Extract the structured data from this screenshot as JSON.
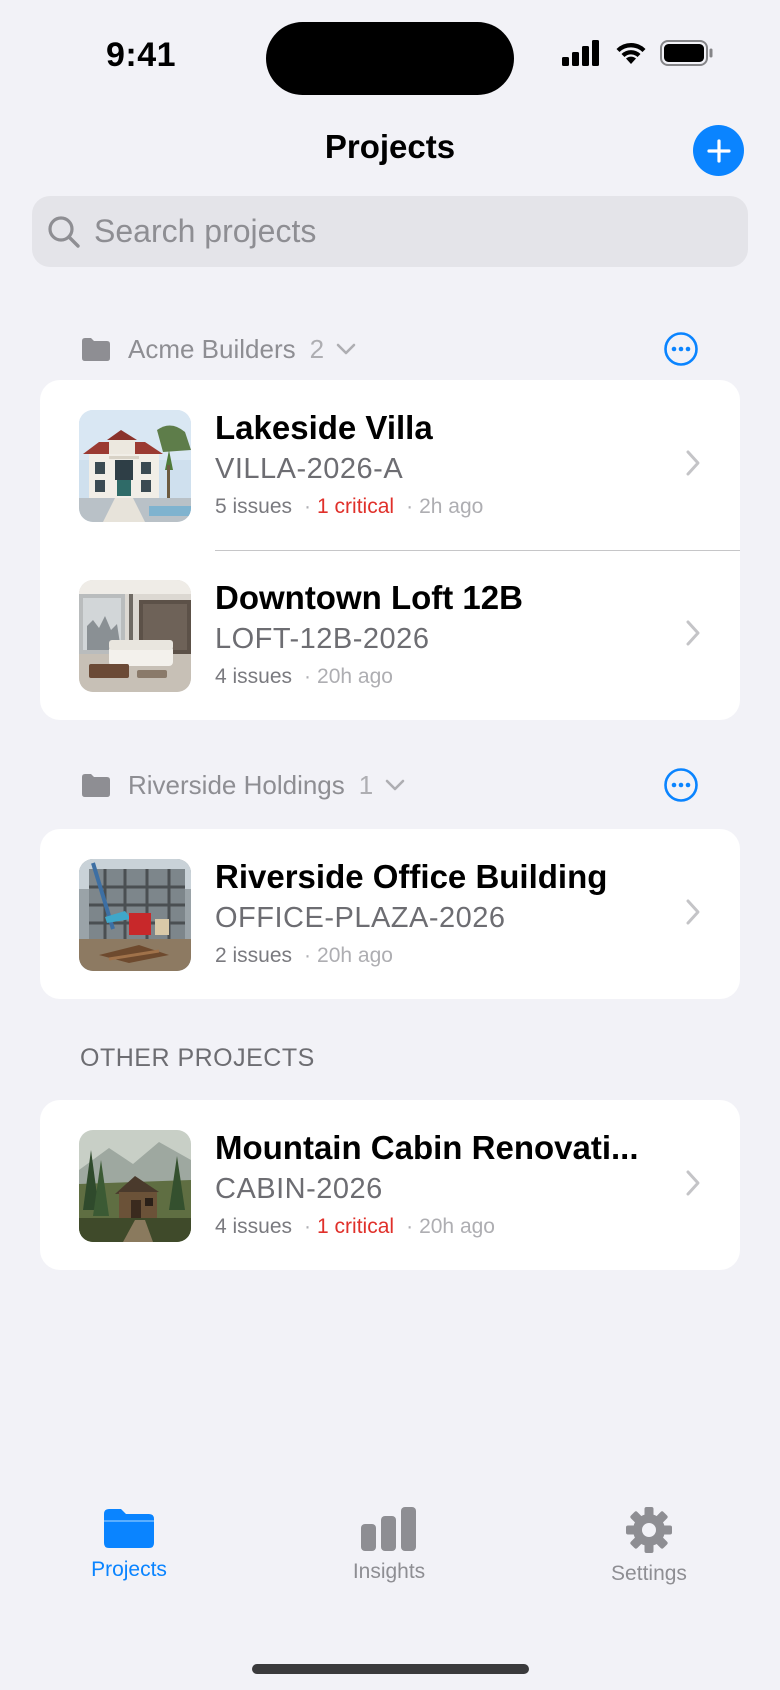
{
  "status_bar": {
    "time": "9:41"
  },
  "nav": {
    "title": "Projects",
    "add_icon": "plus-icon"
  },
  "search": {
    "placeholder": "Search projects",
    "value": ""
  },
  "groups": [
    {
      "name": "Acme Builders",
      "count": "2",
      "projects": [
        {
          "name": "Lakeside Villa",
          "code": "VILLA-2026-A",
          "issues": "5 issues",
          "critical": "1 critical",
          "updated": "2h ago"
        },
        {
          "name": "Downtown Loft 12B",
          "code": "LOFT-12B-2026",
          "issues": "4 issues",
          "critical": "",
          "updated": "20h ago"
        }
      ]
    },
    {
      "name": "Riverside Holdings",
      "count": "1",
      "projects": [
        {
          "name": "Riverside Office Building",
          "code": "OFFICE-PLAZA-2026",
          "issues": "2 issues",
          "critical": "",
          "updated": "20h ago"
        }
      ]
    }
  ],
  "other": {
    "header": "OTHER PROJECTS",
    "projects": [
      {
        "name": "Mountain Cabin Renovati...",
        "code": "CABIN-2026",
        "issues": "4 issues",
        "critical": "1 critical",
        "updated": "20h ago"
      }
    ]
  },
  "tab_bar": {
    "tabs": [
      {
        "label": "Projects",
        "icon": "folder-icon",
        "active": true
      },
      {
        "label": "Insights",
        "icon": "bar-chart-icon",
        "active": false
      },
      {
        "label": "Settings",
        "icon": "gear-icon",
        "active": false
      }
    ]
  },
  "colors": {
    "accent": "#0a84ff",
    "critical": "#e0302a",
    "background": "#f2f2f7"
  }
}
